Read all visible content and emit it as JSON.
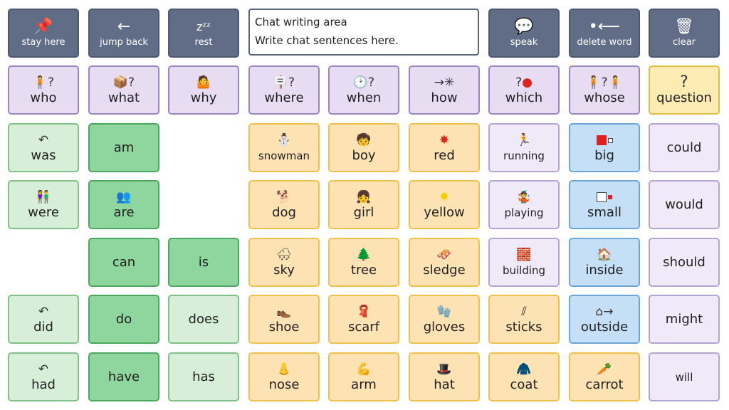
{
  "toolbar": {
    "stay_here": {
      "label": "stay here",
      "icon": "pin-icon"
    },
    "jump_back": {
      "label": "jump back",
      "icon": "arrow-left-icon"
    },
    "rest": {
      "label": "rest",
      "icon": "zzz-icon"
    },
    "speak": {
      "label": "speak",
      "icon": "speech-bubble-icon"
    },
    "delete_word": {
      "label": "delete word",
      "icon": "delete-word-icon"
    },
    "clear": {
      "label": "clear",
      "icon": "trash-icon"
    }
  },
  "chat_area": {
    "title": "Chat writing area",
    "placeholder": "Write chat sentences here."
  },
  "questions": {
    "who": "who",
    "what": "what",
    "why": "why",
    "where": "where",
    "when": "when",
    "how": "how",
    "which": "which",
    "whose": "whose",
    "question": "question"
  },
  "verbs": {
    "was": "was",
    "am": "am",
    "were": "were",
    "are": "are",
    "can": "can",
    "is": "is",
    "did": "did",
    "do": "do",
    "does": "does",
    "had": "had",
    "have": "have",
    "has": "has"
  },
  "nouns": {
    "snowman": "snowman",
    "boy": "boy",
    "red": "red",
    "dog": "dog",
    "girl": "girl",
    "yellow": "yellow",
    "sky": "sky",
    "tree": "tree",
    "sledge": "sledge",
    "shoe": "shoe",
    "scarf": "scarf",
    "gloves": "gloves",
    "nose": "nose",
    "arm": "arm",
    "hat": "hat"
  },
  "actions": {
    "running": "running",
    "playing": "playing",
    "building": "building",
    "sticks": "sticks",
    "coat": "coat"
  },
  "descriptors": {
    "big": "big",
    "small": "small",
    "inside": "inside",
    "outside": "outside",
    "carrot": "carrot"
  },
  "modals": {
    "could": "could",
    "would": "would",
    "should": "should",
    "might": "might",
    "will": "will"
  },
  "colors": {
    "toolbar": "#616d86",
    "question": "#e8dcf3",
    "question_highlight": "#fcebb2",
    "verb_light": "#d7eed8",
    "verb_dark": "#8ed59e",
    "noun": "#fde2b4",
    "action": "#f0eaf8",
    "descriptor": "#c5dff7"
  }
}
